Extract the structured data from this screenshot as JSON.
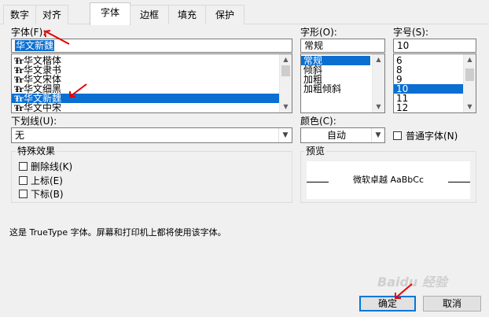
{
  "tabs": [
    "数字",
    "对齐",
    "字体",
    "边框",
    "填充",
    "保护"
  ],
  "active_tab": "字体",
  "font": {
    "label": "字体(F):",
    "value": "华文新魏",
    "list": [
      {
        "icon": "Ŧr",
        "name": "华文楷体"
      },
      {
        "icon": "Ŧr",
        "name": "华文隶书"
      },
      {
        "icon": "Ŧr",
        "name": "华文宋体"
      },
      {
        "icon": "Ŧr",
        "name": "华文细黑"
      },
      {
        "icon": "Ŧr",
        "name": "华文新魏"
      },
      {
        "icon": "Ŧr",
        "name": "华文中宋"
      }
    ]
  },
  "style": {
    "label": "字形(O):",
    "value": "常规",
    "list": [
      "常规",
      "倾斜",
      "加粗",
      "加粗倾斜"
    ]
  },
  "size": {
    "label": "字号(S):",
    "value": "10",
    "list": [
      "6",
      "8",
      "9",
      "10",
      "11",
      "12"
    ]
  },
  "underline": {
    "label": "下划线(U):",
    "value": "无"
  },
  "color": {
    "label": "颜色(C):",
    "value": "自动"
  },
  "normal_font": {
    "label": "普通字体(N)"
  },
  "effects": {
    "title": "特殊效果",
    "items": [
      "删除线(K)",
      "上标(E)",
      "下标(B)"
    ]
  },
  "preview": {
    "title": "预览",
    "sample": "微软卓越 AaBbCc"
  },
  "info_text": "这是 TrueType 字体。屏幕和打印机上都将使用该字体。",
  "buttons": {
    "ok": "确定",
    "cancel": "取消"
  },
  "watermark": "Baidu 经验",
  "colors": {
    "selection": "#0a6fd1",
    "arrow": "#e60000",
    "default_button": "#0078d7"
  }
}
